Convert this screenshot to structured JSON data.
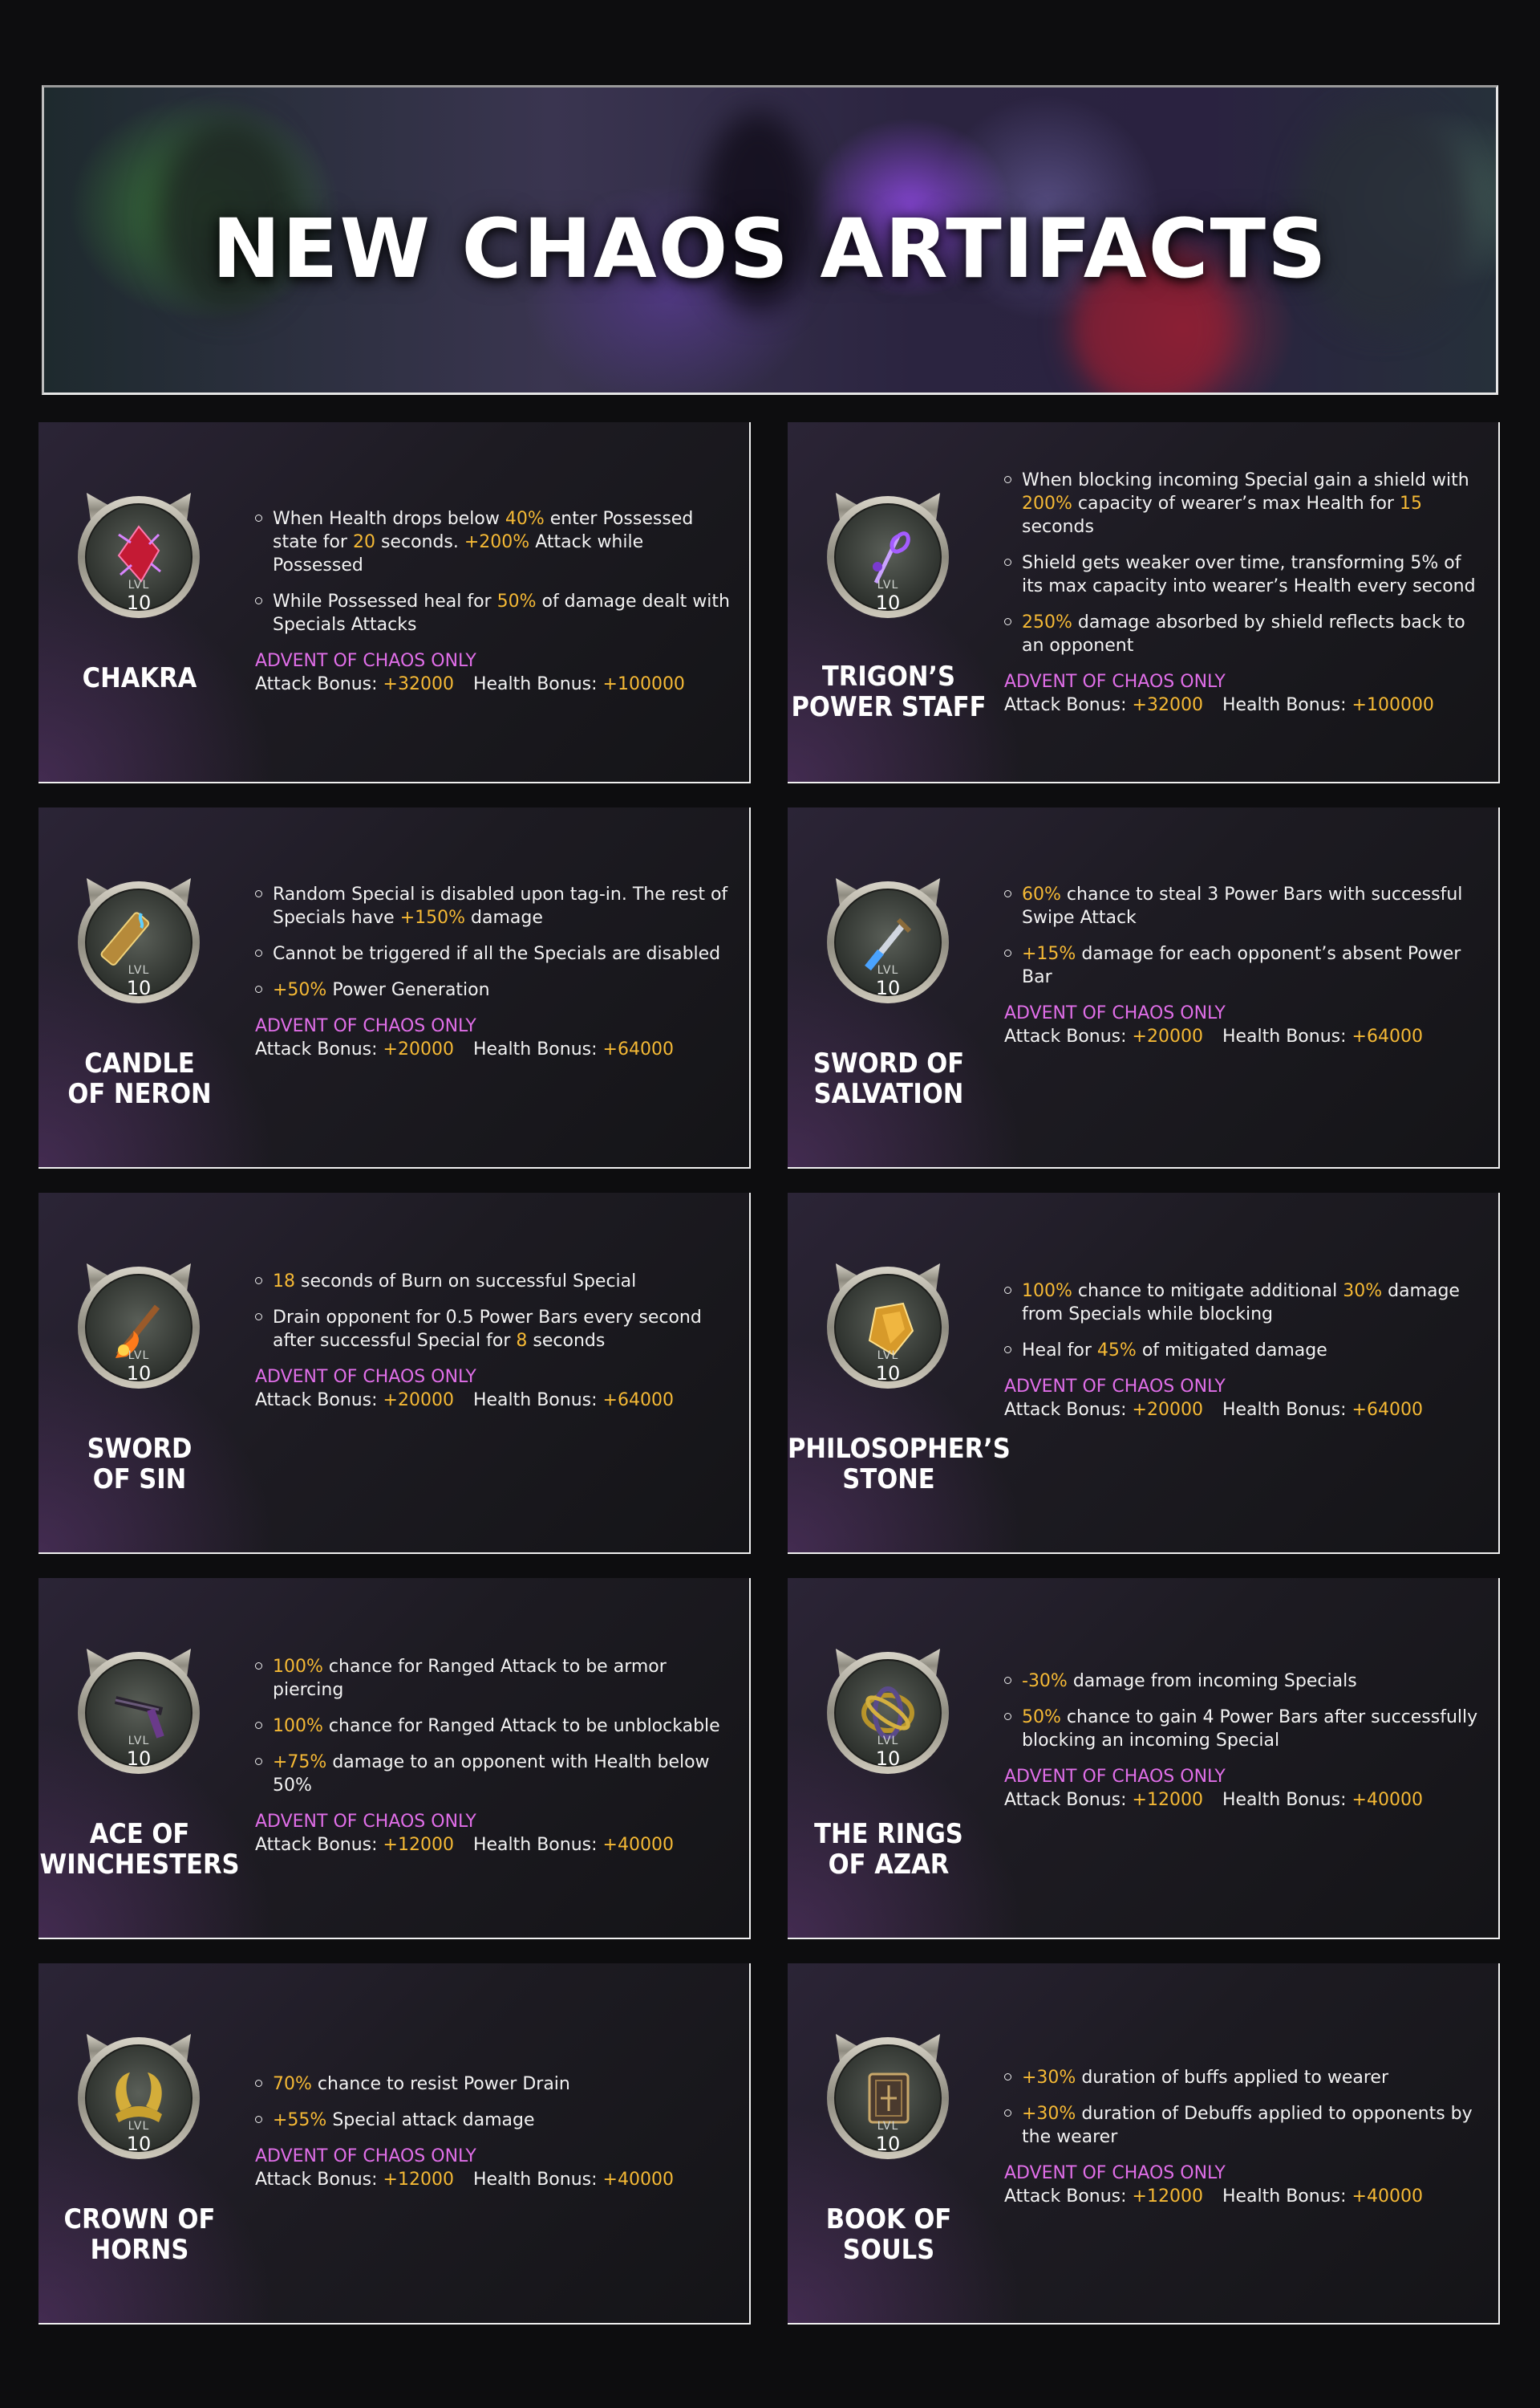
{
  "banner": {
    "title": "NEW CHAOS ARTIFACTS"
  },
  "colors": {
    "highlight": "#f5b935",
    "advent": "#e06ee8",
    "text": "#f2f2f2"
  },
  "common": {
    "advent_label": "ADVENT OF CHAOS ONLY",
    "attack_label": "Attack Bonus:",
    "health_label": "Health Bonus:",
    "lvl_label": "LVL",
    "lvl_value": "10"
  },
  "artifacts": [
    {
      "name": [
        "CHAKRA"
      ],
      "icon": "red-crystal-icon",
      "bullets": [
        [
          [
            "When Health drops below ",
            0
          ],
          [
            "40%",
            1
          ],
          [
            " enter Possessed state for ",
            0
          ],
          [
            "20",
            1
          ],
          [
            " seconds. ",
            0
          ],
          [
            "+200%",
            1
          ],
          [
            " Attack while Possessed",
            0
          ]
        ],
        [
          [
            "While Possessed heal for ",
            0
          ],
          [
            "50%",
            1
          ],
          [
            " of damage dealt with Specials Attacks",
            0
          ]
        ]
      ],
      "attack": "+32000",
      "health": "+100000"
    },
    {
      "name": [
        "TRIGON’S",
        "POWER STAFF"
      ],
      "icon": "staff-icon",
      "bullets": [
        [
          [
            "When blocking incoming Special gain a shield with ",
            0
          ],
          [
            "200%",
            1
          ],
          [
            " capacity of wearer’s max Health for ",
            0
          ],
          [
            "15",
            1
          ],
          [
            " seconds",
            0
          ]
        ],
        [
          [
            "Shield gets weaker over time, transforming 5% of its max capacity into wearer’s Health every second",
            0
          ]
        ],
        [
          [
            "250%",
            1
          ],
          [
            " damage absorbed by shield reflects back to an opponent",
            0
          ]
        ]
      ],
      "attack": "+32000",
      "health": "+100000"
    },
    {
      "name": [
        "CANDLE",
        "OF NERON"
      ],
      "icon": "candle-icon",
      "bullets": [
        [
          [
            "Random Special is disabled upon tag-in. The rest of Specials have ",
            0
          ],
          [
            "+150%",
            1
          ],
          [
            " damage",
            0
          ]
        ],
        [
          [
            "Cannot be triggered if all the Specials are disabled",
            0
          ]
        ],
        [
          [
            "+50%",
            1
          ],
          [
            " Power Generation",
            0
          ]
        ]
      ],
      "attack": "+20000",
      "health": "+64000"
    },
    {
      "name": [
        "SWORD OF",
        "SALVATION"
      ],
      "icon": "blue-sword-icon",
      "bullets": [
        [
          [
            "60%",
            1
          ],
          [
            " chance to steal 3 Power Bars with successful Swipe Attack",
            0
          ]
        ],
        [
          [
            "+15%",
            1
          ],
          [
            " damage for each opponent’s absent Power Bar",
            0
          ]
        ]
      ],
      "attack": "+20000",
      "health": "+64000"
    },
    {
      "name": [
        "SWORD",
        "OF SIN"
      ],
      "icon": "fire-sword-icon",
      "bullets": [
        [
          [
            "18",
            1
          ],
          [
            " seconds of Burn on successful Special",
            0
          ]
        ],
        [
          [
            "Drain opponent for 0.5 Power Bars every second after successful Special for ",
            0
          ],
          [
            "8",
            1
          ],
          [
            " seconds",
            0
          ]
        ]
      ],
      "attack": "+20000",
      "health": "+64000"
    },
    {
      "name": [
        "PHILOSOPHER’S",
        "STONE"
      ],
      "icon": "stone-icon",
      "bullets": [
        [
          [
            "100%",
            1
          ],
          [
            " chance to mitigate additional ",
            0
          ],
          [
            "30%",
            1
          ],
          [
            " damage from Specials while blocking",
            0
          ]
        ],
        [
          [
            "Heal for ",
            0
          ],
          [
            "45%",
            1
          ],
          [
            " of mitigated damage",
            0
          ]
        ]
      ],
      "attack": "+20000",
      "health": "+64000"
    },
    {
      "name": [
        "ACE OF",
        "WINCHESTERS"
      ],
      "icon": "shotgun-icon",
      "bullets": [
        [
          [
            "100%",
            1
          ],
          [
            " chance for Ranged Attack to be armor piercing",
            0
          ]
        ],
        [
          [
            "100%",
            1
          ],
          [
            " chance for Ranged Attack to be unblockable",
            0
          ]
        ],
        [
          [
            "+75%",
            1
          ],
          [
            " damage to an opponent with Health below 50%",
            0
          ]
        ]
      ],
      "attack": "+12000",
      "health": "+40000"
    },
    {
      "name": [
        "THE RINGS",
        "OF AZAR"
      ],
      "icon": "rings-icon",
      "bullets": [
        [
          [
            "-30%",
            1
          ],
          [
            " damage from incoming Specials",
            0
          ]
        ],
        [
          [
            "50%",
            1
          ],
          [
            " chance to gain 4 Power Bars after successfully blocking an incoming Special",
            0
          ]
        ]
      ],
      "attack": "+12000",
      "health": "+40000"
    },
    {
      "name": [
        "CROWN OF",
        "HORNS"
      ],
      "icon": "horned-crown-icon",
      "bullets": [
        [
          [
            "70%",
            1
          ],
          [
            " chance to resist Power Drain",
            0
          ]
        ],
        [
          [
            "+55%",
            1
          ],
          [
            " Special attack damage",
            0
          ]
        ]
      ],
      "attack": "+12000",
      "health": "+40000"
    },
    {
      "name": [
        "BOOK OF",
        "SOULS"
      ],
      "icon": "book-icon",
      "bullets": [
        [
          [
            "+30%",
            1
          ],
          [
            " duration of buffs applied to wearer",
            0
          ]
        ],
        [
          [
            "+30%",
            1
          ],
          [
            " duration of Debuffs applied to opponents by the wearer",
            0
          ]
        ]
      ],
      "attack": "+12000",
      "health": "+40000"
    }
  ]
}
